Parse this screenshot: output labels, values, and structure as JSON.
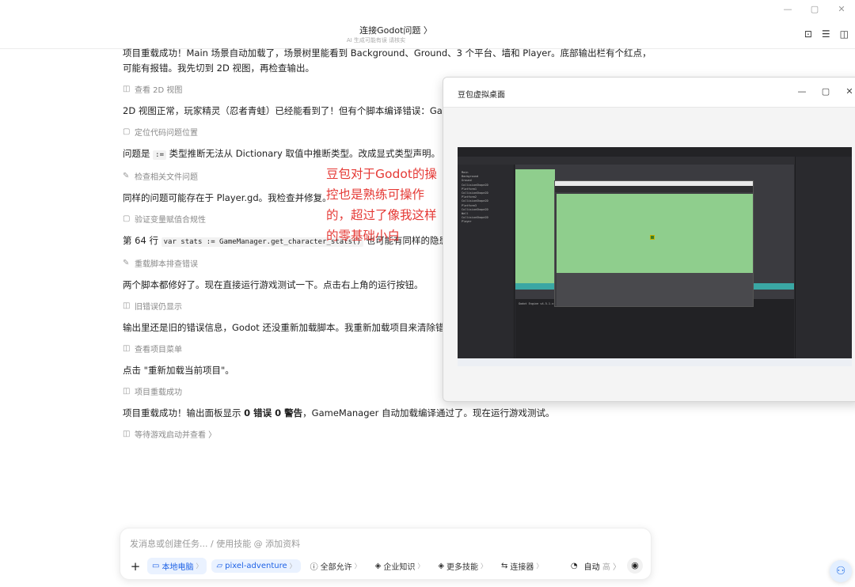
{
  "window": {
    "minimize": "—",
    "maximize": "▢",
    "close": "✕"
  },
  "header": {
    "title": "连接Godot问题 〉",
    "subtitle": "AI 生成可能有误 请核实",
    "icons": [
      "new-chat-icon",
      "list-icon",
      "sidebar-icon"
    ]
  },
  "messages": [
    {
      "type": "para",
      "text": "项目重载成功！Main 场景自动加载了，场景树里能看到 Background、Ground、3 个平台、墙和 Player。底部输出栏有个红点，可能有报错。我先切到 2D 视图，再检查输出。"
    },
    {
      "type": "step",
      "icon": "view-icon",
      "text": "查看 2D 视图"
    },
    {
      "type": "para",
      "text": "2D 视图正常，玩家精灵（忍者青蛙）已经能看到了！但有个脚本编译错误：GameManager"
    },
    {
      "type": "step",
      "icon": "book-icon",
      "text": "定位代码问题位置"
    },
    {
      "type": "para_code",
      "before": "问题是 ",
      "code": ":=",
      "after": " 类型推断无法从 Dictionary 取值中推断类型。改成显式类型声明。"
    },
    {
      "type": "step",
      "icon": "edit-icon",
      "text": "检查相关文件问题"
    },
    {
      "type": "para",
      "text": "同样的问题可能存在于 Player.gd。我检查并修复。"
    },
    {
      "type": "step",
      "icon": "book-icon",
      "text": "验证变量赋值合规性"
    },
    {
      "type": "para_code",
      "before": "第 64 行 ",
      "code": "var stats := GameManager.get_character_stats()",
      "after": " 也可能有同样的隐患，我"
    },
    {
      "type": "step",
      "icon": "edit-icon",
      "text": "重载脚本排查错误"
    },
    {
      "type": "para",
      "text": "两个脚本都修好了。现在直接运行游戏测试一下。点击右上角的运行按钮。"
    },
    {
      "type": "step",
      "icon": "view-icon",
      "text": "旧错误仍显示"
    },
    {
      "type": "para",
      "text": "输出里还是旧的错误信息，Godot 还没重新加载脚本。我重新加载项目来清除错误并"
    },
    {
      "type": "step",
      "icon": "view-icon",
      "text": "查看项目菜单"
    },
    {
      "type": "para",
      "text": "点击 \"重新加载当前项目\"。"
    },
    {
      "type": "step",
      "icon": "view-icon",
      "text": "项目重载成功"
    },
    {
      "type": "para_bold",
      "t1": "项目重载成功！输出面板显示 ",
      "b1": "0 错误 0 警告",
      "t2": "，GameManager 自动加载编译通过了。现在运行游戏测试。"
    },
    {
      "type": "step",
      "icon": "view-icon",
      "text": "等待游戏启动并查看 〉"
    }
  ],
  "annotation": "豆包对于Godot的操控也是熟练可操作的，超过了像我这样的零基础小白",
  "virtual_desktop": {
    "title": "豆包虚拟桌面",
    "controls": [
      "—",
      "▢",
      "✕"
    ],
    "godot_version_text": "Godot Engine v4.5.1.stable",
    "scene_tree": [
      "Main",
      "Background",
      "Ground",
      "CollisionShape2D",
      "Platform1",
      "CollisionShape2D",
      "Platform2",
      "CollisionShape2D",
      "Platform3",
      "CollisionShape2D",
      "Wall",
      "CollisionShape2D",
      "Player"
    ]
  },
  "composer": {
    "placeholder": "发消息或创建任务... / 使用技能 @ 添加资料",
    "chips": [
      {
        "icon": "laptop-icon",
        "label": "本地电脑",
        "active": true
      },
      {
        "icon": "folder-icon",
        "label": "pixel-adventure",
        "active": true
      },
      {
        "icon": "permission-icon",
        "label": "全部允许",
        "active": false
      },
      {
        "icon": "layers-icon",
        "label": "企业知识",
        "active": false
      },
      {
        "icon": "layers-icon",
        "label": "更多技能",
        "active": false
      },
      {
        "icon": "connector-icon",
        "label": "连接器",
        "active": false
      }
    ],
    "mode": "自动",
    "mode_hint": "高",
    "accent": "#1e62e6"
  }
}
